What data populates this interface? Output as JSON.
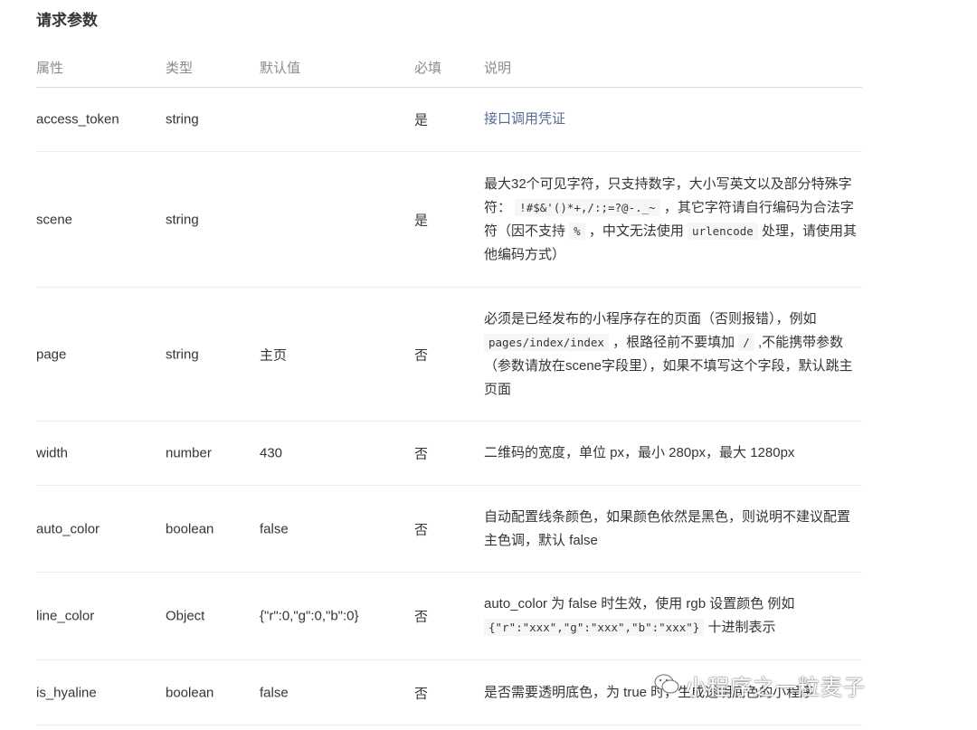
{
  "title": "请求参数",
  "headers": {
    "name": "属性",
    "type": "类型",
    "default": "默认值",
    "required": "必填",
    "desc": "说明"
  },
  "rows": [
    {
      "name": "access_token",
      "type": "string",
      "default": "",
      "required": "是",
      "desc": "接口调用凭证"
    },
    {
      "name": "scene",
      "type": "string",
      "default": "",
      "required": "是",
      "desc_parts": [
        "最大32个可见字符，只支持数字，大小写英文以及部分特殊字符： ",
        "!#$&'()*+,/:;=?@-._~",
        " ，其它字符请自行编码为合法字符（因不支持 ",
        "%",
        " ，中文无法使用 ",
        "urlencode",
        " 处理，请使用其他编码方式）"
      ]
    },
    {
      "name": "page",
      "type": "string",
      "default": "主页",
      "required": "否",
      "desc_parts": [
        "必须是已经发布的小程序存在的页面（否则报错），例如 ",
        "pages/index/index",
        " ，根路径前不要填加 ",
        "/",
        " ,不能携带参数（参数请放在scene字段里），如果不填写这个字段，默认跳主页面"
      ]
    },
    {
      "name": "width",
      "type": "number",
      "default": "430",
      "required": "否",
      "desc": "二维码的宽度，单位 px，最小 280px，最大 1280px"
    },
    {
      "name": "auto_color",
      "type": "boolean",
      "default": "false",
      "required": "否",
      "desc": "自动配置线条颜色，如果颜色依然是黑色，则说明不建议配置主色调，默认 false"
    },
    {
      "name": "line_color",
      "type": "Object",
      "default": "{\"r\":0,\"g\":0,\"b\":0}",
      "required": "否",
      "desc_parts": [
        "auto_color 为 false 时生效，使用 rgb 设置颜色 例如 ",
        "{\"r\":\"xxx\",\"g\":\"xxx\",\"b\":\"xxx\"}",
        " 十进制表示"
      ]
    },
    {
      "name": "is_hyaline",
      "type": "boolean",
      "default": "false",
      "required": "否",
      "desc": "是否需要透明底色，为 true 时，生成透明底色的小程序"
    }
  ],
  "watermark": "小程序之一粒麦子",
  "colors": {
    "link": "#576b95",
    "text": "#353535",
    "header": "#8c8c8c"
  }
}
